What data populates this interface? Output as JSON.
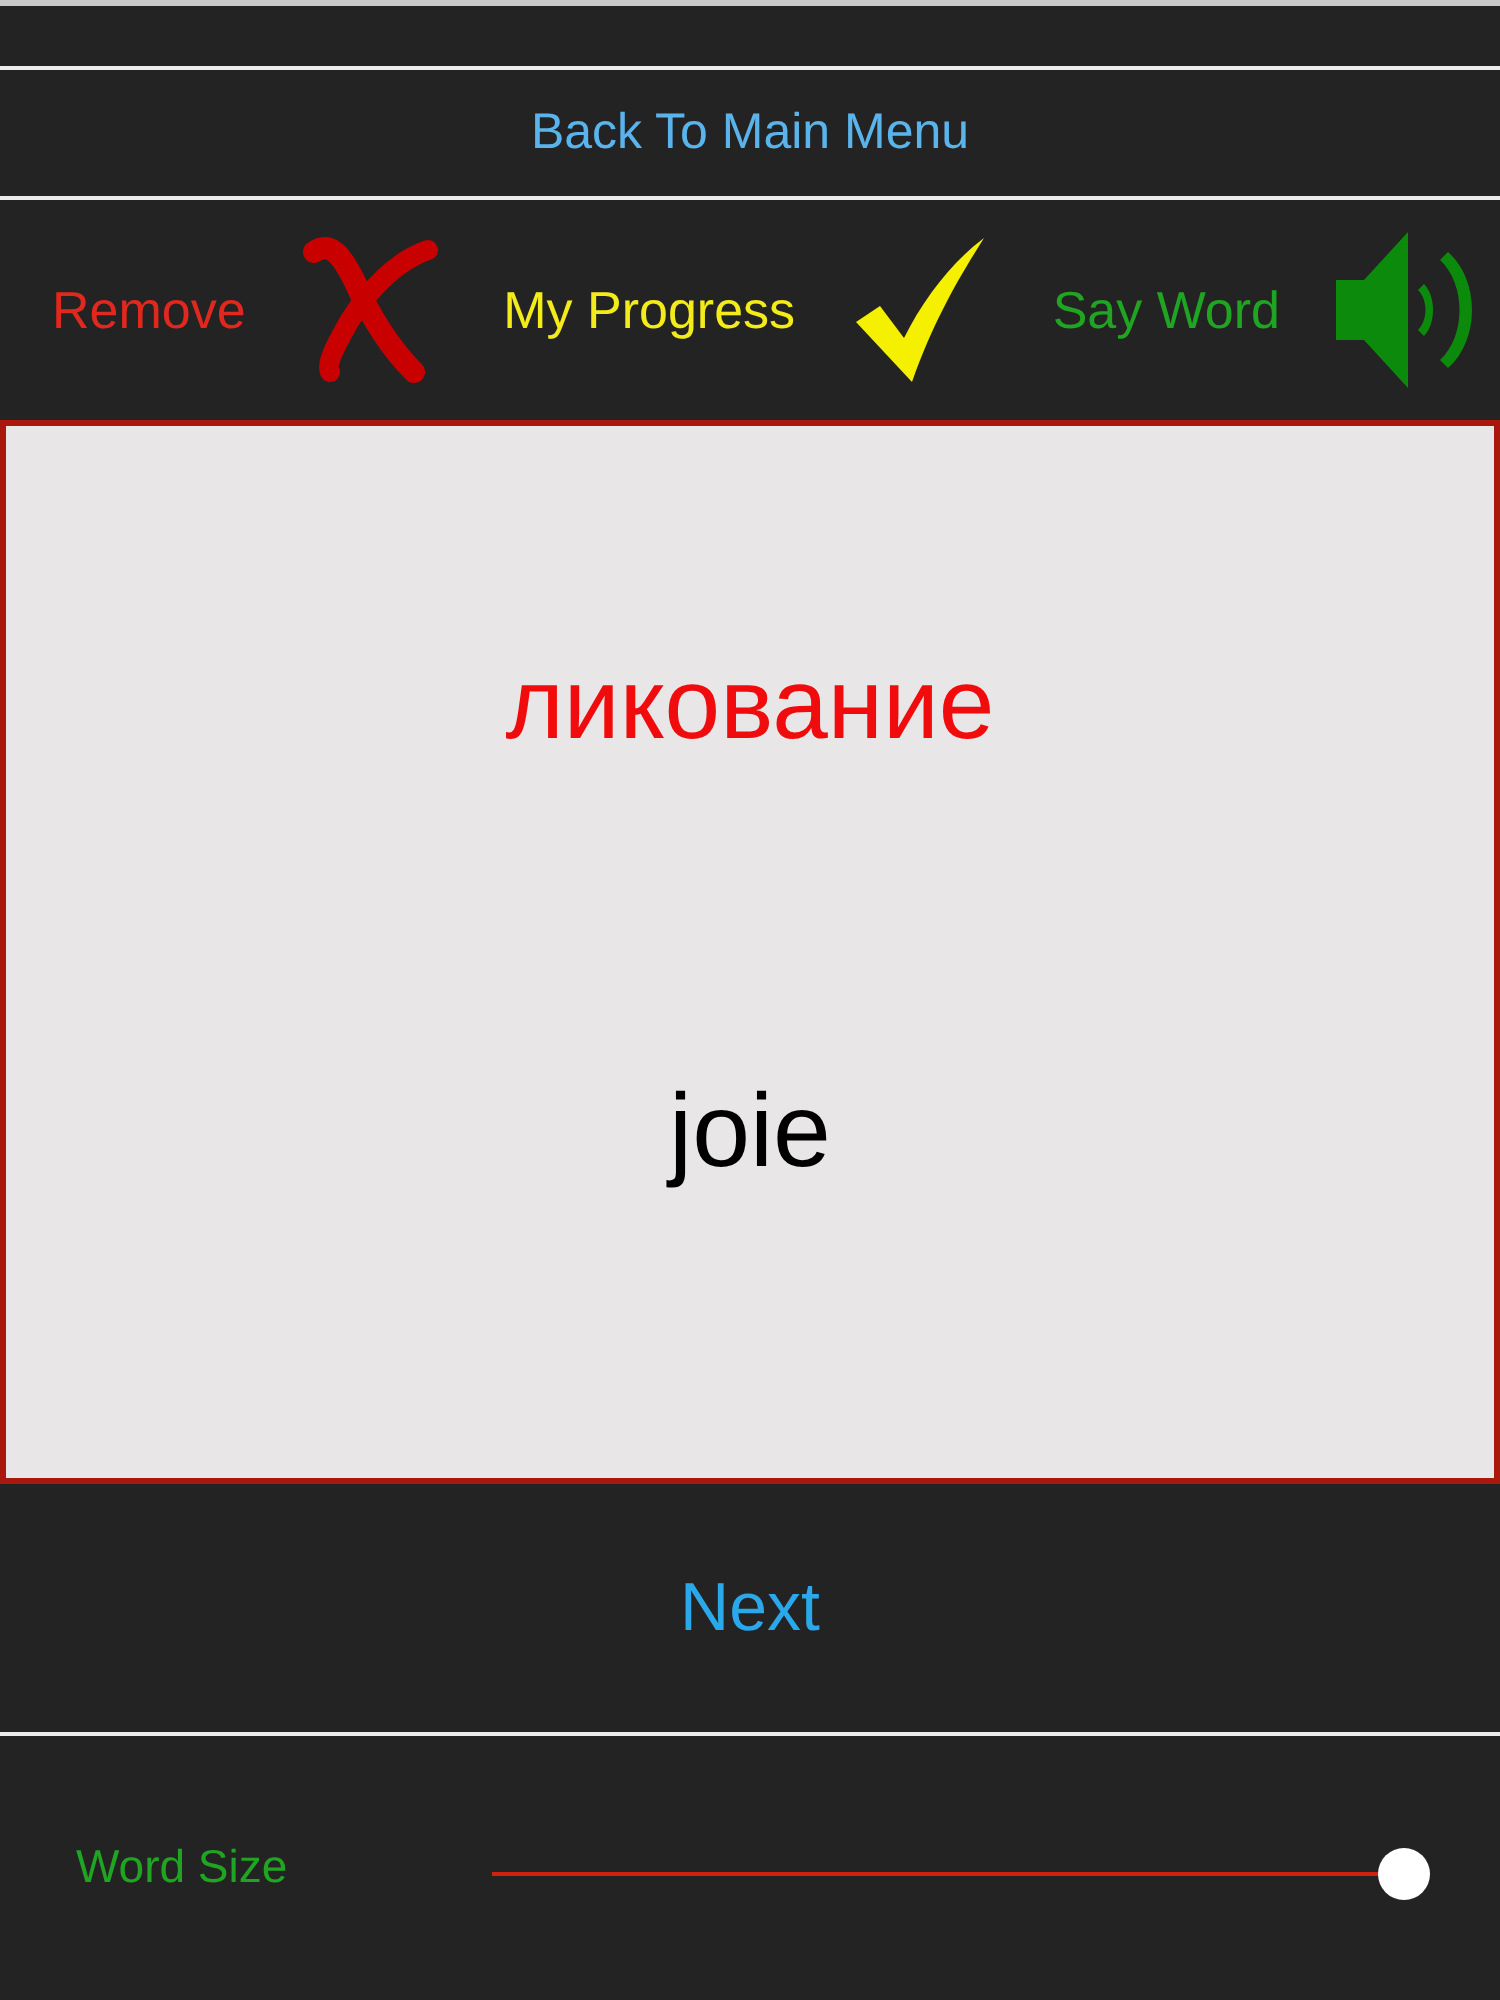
{
  "back_button": {
    "label": "Back To Main Menu"
  },
  "actions": [
    {
      "kind": "remove",
      "label": "Remove"
    },
    {
      "kind": "progress",
      "label": "My Progress"
    },
    {
      "kind": "speak",
      "label": "Say Word"
    }
  ],
  "card": {
    "word": "ликование",
    "translation": "joie"
  },
  "next_button": {
    "label": "Next"
  },
  "word_size": {
    "label": "Word Size",
    "level": 1
  }
}
